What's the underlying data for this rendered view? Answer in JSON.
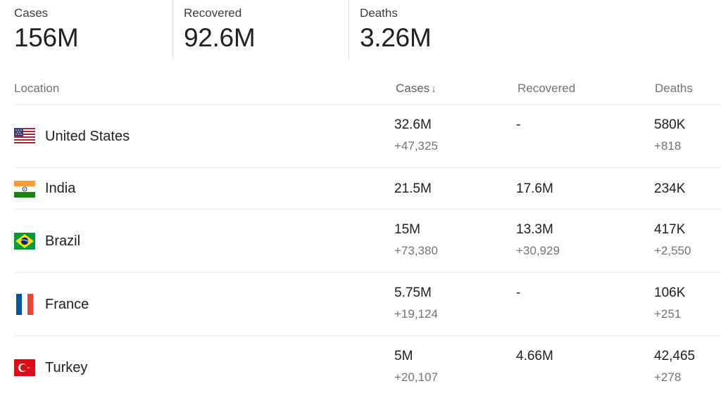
{
  "summary": {
    "cases": {
      "label": "Cases",
      "value": "156M"
    },
    "recovered": {
      "label": "Recovered",
      "value": "92.6M"
    },
    "deaths": {
      "label": "Deaths",
      "value": "3.26M"
    }
  },
  "table": {
    "headers": {
      "location": "Location",
      "cases": "Cases",
      "recovered": "Recovered",
      "deaths": "Deaths",
      "sort_indicator": "↓"
    },
    "rows": [
      {
        "country": "United States",
        "flag": "us-flag-icon",
        "cases": "32.6M",
        "cases_delta": "+47,325",
        "recovered": "-",
        "recovered_delta": "",
        "deaths": "580K",
        "deaths_delta": "+818"
      },
      {
        "country": "India",
        "flag": "india-flag-icon",
        "cases": "21.5M",
        "cases_delta": "",
        "recovered": "17.6M",
        "recovered_delta": "",
        "deaths": "234K",
        "deaths_delta": ""
      },
      {
        "country": "Brazil",
        "flag": "brazil-flag-icon",
        "cases": "15M",
        "cases_delta": "+73,380",
        "recovered": "13.3M",
        "recovered_delta": "+30,929",
        "deaths": "417K",
        "deaths_delta": "+2,550"
      },
      {
        "country": "France",
        "flag": "france-flag-icon",
        "cases": "5.75M",
        "cases_delta": "+19,124",
        "recovered": "-",
        "recovered_delta": "",
        "deaths": "106K",
        "deaths_delta": "+251"
      },
      {
        "country": "Turkey",
        "flag": "turkey-flag-icon",
        "cases": "5M",
        "cases_delta": "+20,107",
        "recovered": "4.66M",
        "recovered_delta": "",
        "deaths": "42,465",
        "deaths_delta": "+278"
      }
    ]
  }
}
